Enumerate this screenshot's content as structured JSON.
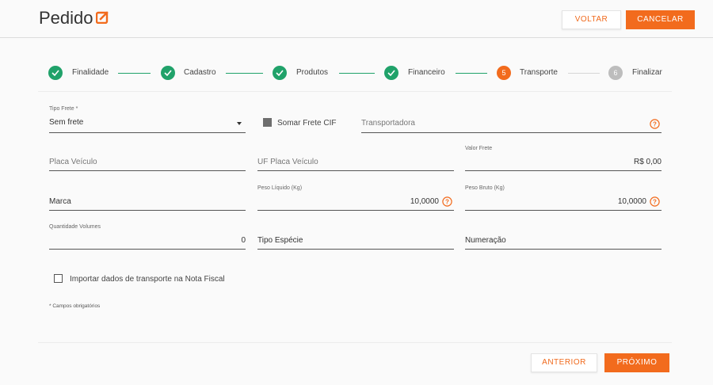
{
  "header": {
    "title": "Pedido",
    "title_icon": "external-link-icon",
    "voltar_label": "VOLTAR",
    "cancelar_label": "CANCELAR"
  },
  "steps": [
    {
      "label": "Finalidade",
      "state": "done"
    },
    {
      "label": "Cadastro",
      "state": "done"
    },
    {
      "label": "Produtos",
      "state": "done"
    },
    {
      "label": "Financeiro",
      "state": "done"
    },
    {
      "label": "Transporte",
      "state": "active",
      "number": "5"
    },
    {
      "label": "Finalizar",
      "state": "pending",
      "number": "6"
    }
  ],
  "form": {
    "tipo_frete_label": "Tipo Frete *",
    "tipo_frete_value": "Sem frete",
    "somar_frete_label": "Somar Frete CIF",
    "transportadora_placeholder": "Transportadora",
    "placa_placeholder": "Placa Veículo",
    "uf_placa_placeholder": "UF Placa Veículo",
    "valor_frete_label": "Valor Frete",
    "valor_frete_value": "R$ 0,00",
    "marca_placeholder": "Marca",
    "peso_liquido_label": "Peso Líquido (Kg)",
    "peso_liquido_value": "10,0000",
    "peso_bruto_label": "Peso Bruto (Kg)",
    "peso_bruto_value": "10,0000",
    "quantidade_label": "Quantidade Volumes",
    "quantidade_value": "0",
    "tipo_especie_placeholder": "Tipo Espécie",
    "numeracao_placeholder": "Numeração",
    "importar_label": "Importar dados de transporte na Nota Fiscal",
    "required_note": "* Campos obrigatórios"
  },
  "footer": {
    "anterior_label": "ANTERIOR",
    "proximo_label": "PRÓXIMO"
  },
  "colors": {
    "accent": "#f26b1d",
    "success": "#20a26a",
    "pending": "#bdbdbd"
  }
}
